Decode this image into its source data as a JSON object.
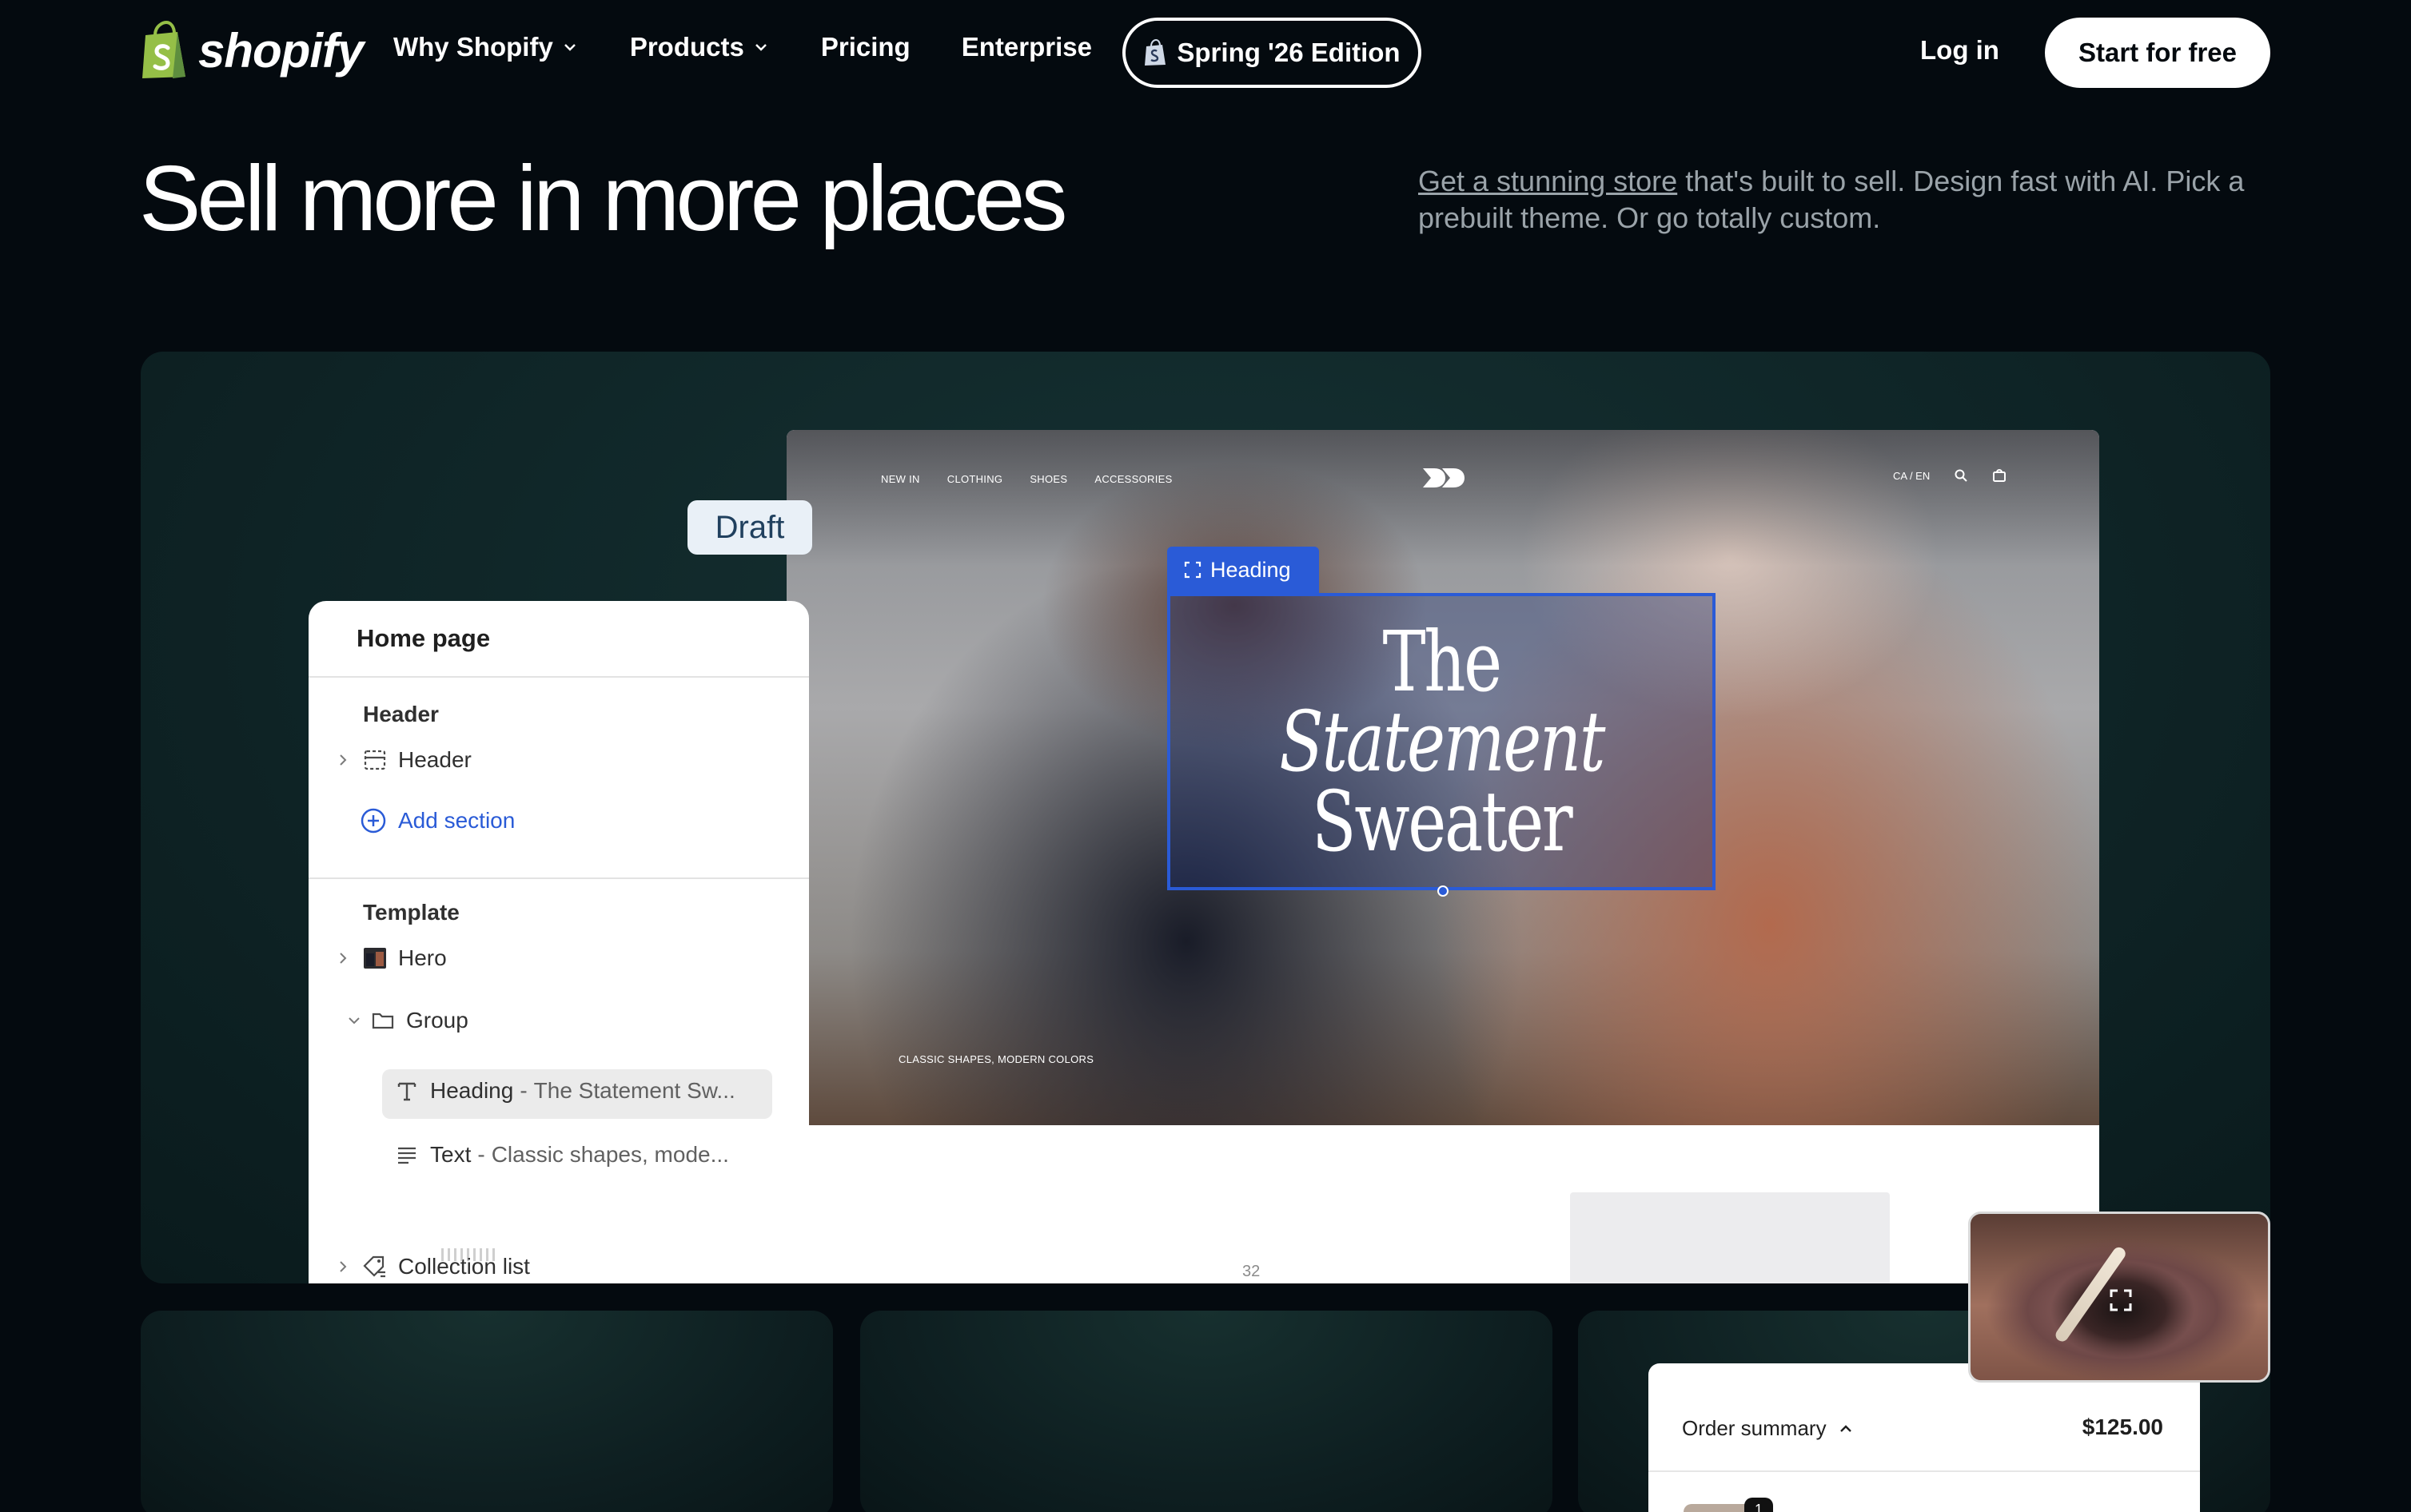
{
  "nav": {
    "logo_text": "shopify",
    "links": [
      "Why Shopify",
      "Products",
      "Pricing",
      "Enterprise"
    ],
    "edition_label": "Spring '26 Edition",
    "login_label": "Log in",
    "start_label": "Start for free"
  },
  "hero": {
    "title": "Sell more in more places",
    "desc_link": "Get a stunning store",
    "desc_rest": " that's built to sell. Design fast with AI. Pick a prebuilt theme. Or go totally custom."
  },
  "editor": {
    "draft_label": "Draft",
    "panel_title": "Home page",
    "header_section_label": "Header",
    "header_item": "Header",
    "add_section": "Add section",
    "template_label": "Template",
    "hero_item": "Hero",
    "group_item": "Group",
    "heading_item": "Heading",
    "heading_sub": "The Statement Sw...",
    "text_item": "Text",
    "text_sub": "Classic shapes, mode...",
    "separator": "-",
    "collection_item": "Collection list"
  },
  "store": {
    "nav": [
      "NEW IN",
      "CLOTHING",
      "SHOES",
      "ACCESSORIES"
    ],
    "locale": "CA / EN",
    "heading_tag": "Heading",
    "heading_lines": [
      "The",
      "Statement",
      "Sweater"
    ],
    "caption": "CLASSIC SHAPES, MODERN COLORS",
    "lower_number": "32"
  },
  "order": {
    "title": "Order summary",
    "price": "$125.00",
    "qty": "1"
  },
  "colors": {
    "background": "#040a0f",
    "accent_blue": "#2a5bd7",
    "shopify_green": "#95bf47"
  }
}
